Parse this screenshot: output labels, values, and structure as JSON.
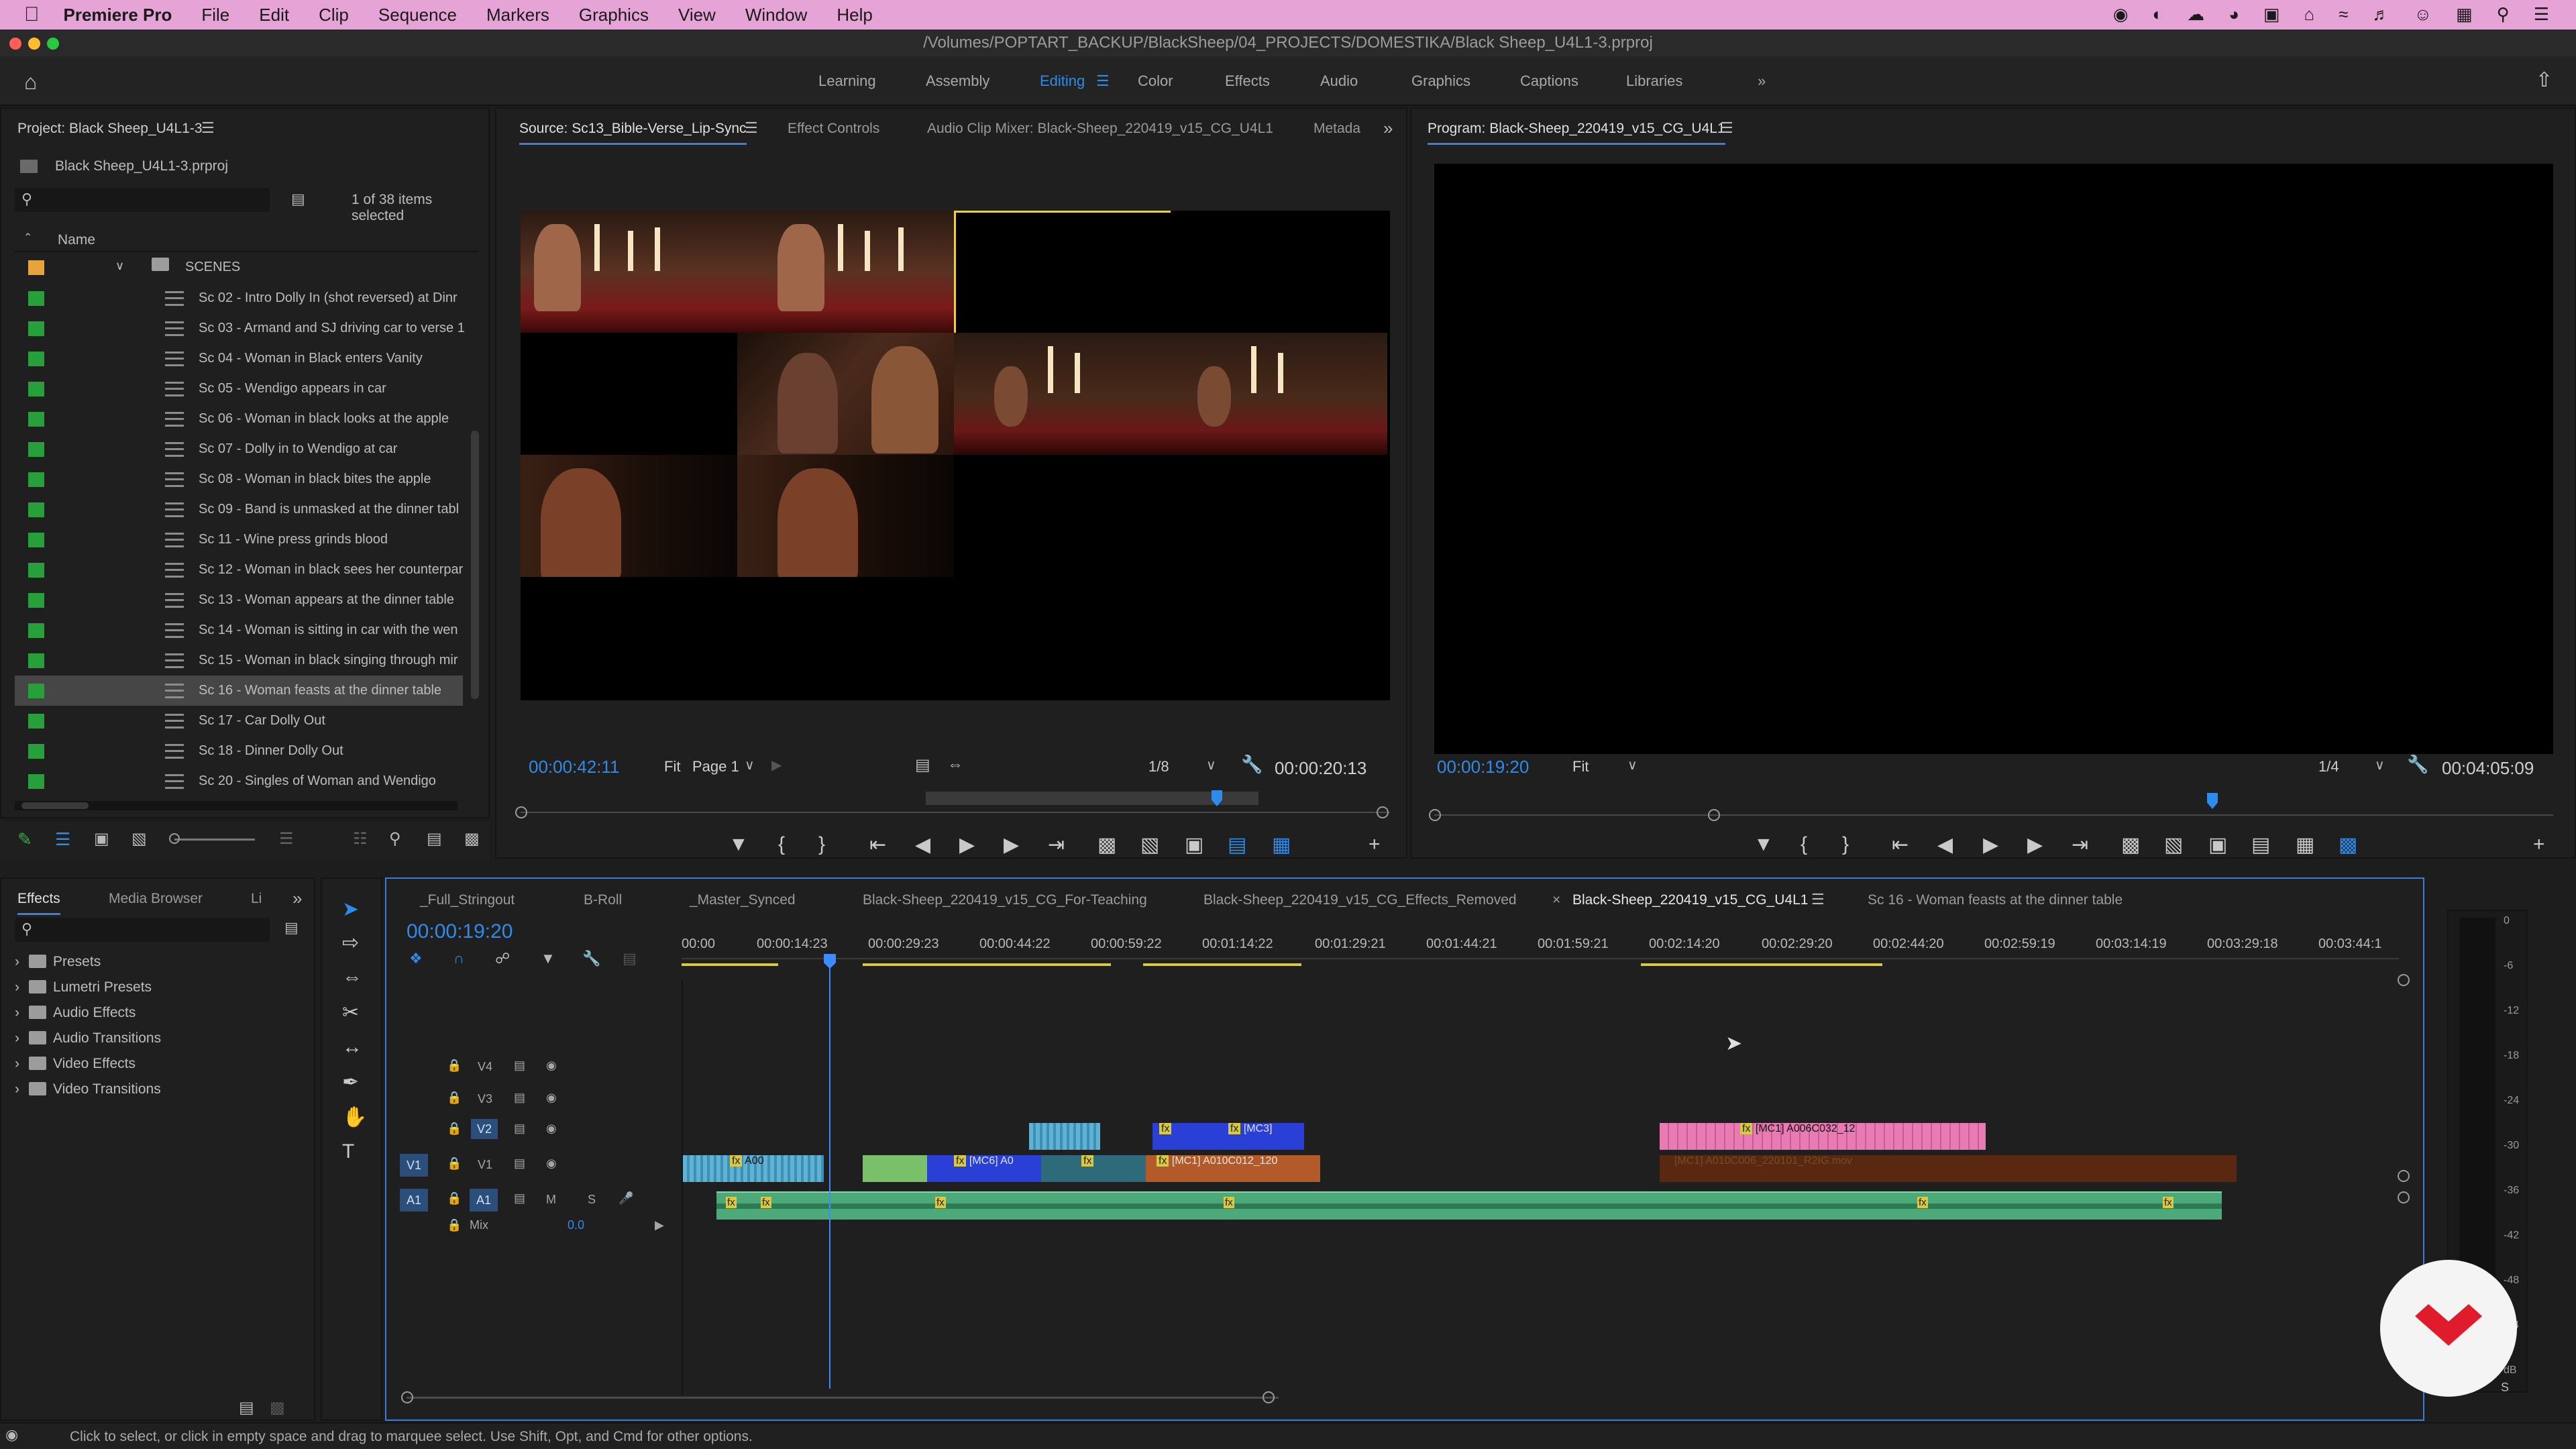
{
  "menubar": {
    "app": "Premiere Pro",
    "items": [
      "File",
      "Edit",
      "Clip",
      "Sequence",
      "Markers",
      "Graphics",
      "View",
      "Window",
      "Help"
    ]
  },
  "window": {
    "title": "/Volumes/POPTART_BACKUP/BlackSheep/04_PROJECTS/DOMESTIKA/Black Sheep_U4L1-3.prproj"
  },
  "workspaces": {
    "items": [
      "Learning",
      "Assembly",
      "Editing",
      "Color",
      "Effects",
      "Audio",
      "Graphics",
      "Captions",
      "Libraries"
    ],
    "active": "Editing"
  },
  "project": {
    "title": "Project: Black Sheep_U4L1-3",
    "file": "Black Sheep_U4L1-3.prproj",
    "search_placeholder": "",
    "selection_info": "1 of 38 items selected",
    "column_name": "Name",
    "folder": "SCENES",
    "items": [
      "Sc 02 - Intro Dolly In (shot reversed) at Dinr",
      "Sc 03 - Armand and SJ driving car to verse 1",
      "Sc 04 - Woman in Black enters Vanity",
      "Sc 05 - Wendigo appears in car",
      "Sc 06 - Woman in black looks at the apple",
      "Sc 07 - Dolly in to Wendigo at car",
      "Sc 08 - Woman in black bites the apple",
      "Sc 09 - Band is unmasked at the dinner tabl",
      "Sc 11 - Wine press grinds blood",
      "Sc 12 - Woman in black sees her counterpar",
      "Sc 13 - Woman appears at the dinner table",
      "Sc 14 - Woman is sitting in car with the wen",
      "Sc 15 - Woman in black singing through mir",
      "Sc 16 - Woman feasts at the dinner table",
      "Sc 17 - Car Dolly Out",
      "Sc 18 - Dinner Dolly Out",
      "Sc 20 - Singles of Woman and Wendigo"
    ],
    "selected_index": 13
  },
  "source": {
    "tabs": [
      "Source: Sc13_Bible-Verse_Lip-Sync",
      "Effect Controls",
      "Audio Clip Mixer: Black-Sheep_220419_v15_CG_U4L1",
      "Metada"
    ],
    "timecode": "00:00:42:11",
    "fit": "Fit",
    "page": "Page 1",
    "resolution": "1/8",
    "duration": "00:00:20:13"
  },
  "program": {
    "title": "Program: Black-Sheep_220419_v15_CG_U4L1",
    "timecode": "00:00:19:20",
    "fit": "Fit",
    "resolution": "1/4",
    "duration": "00:04:05:09"
  },
  "effects": {
    "tabs": [
      "Effects",
      "Media Browser",
      "Li"
    ],
    "items": [
      "Presets",
      "Lumetri Presets",
      "Audio Effects",
      "Audio Transitions",
      "Video Effects",
      "Video Transitions"
    ]
  },
  "timeline": {
    "tabs": [
      "_Full_Stringout",
      "B-Roll",
      "_Master_Synced",
      "Black-Sheep_220419_v15_CG_For-Teaching",
      "Black-Sheep_220419_v15_CG_Effects_Removed",
      "Black-Sheep_220419_v15_CG_U4L1",
      "Sc 16 - Woman feasts at the dinner table"
    ],
    "active_tab": "Black-Sheep_220419_v15_CG_U4L1",
    "close_glyph": "×",
    "timecode": "00:00:19:20",
    "ruler": [
      "00:00",
      "00:00:14:23",
      "00:00:29:23",
      "00:00:44:22",
      "00:00:59:22",
      "00:01:14:22",
      "00:01:29:21",
      "00:01:44:21",
      "00:01:59:21",
      "00:02:14:20",
      "00:02:29:20",
      "00:02:44:20",
      "00:02:59:19",
      "00:03:14:19",
      "00:03:29:18",
      "00:03:44:1"
    ],
    "tracks": {
      "v4": "V4",
      "v3": "V3",
      "v2": "V2",
      "v1": "V1",
      "a1": "A1",
      "mix": "Mix",
      "mix_value": "0.0",
      "m": "M",
      "s": "S"
    },
    "clips": {
      "a00": "A00",
      "mc6": "[MC6] A0",
      "mc1_v1": "[MC1] A010C012_120",
      "mc3": "[MC3]",
      "mc1_v2": "[MC1] A006C032_12",
      "mc1_v1b": "[MC1] A010C006_220101_R2IG.mov",
      "fx": "fx"
    }
  },
  "meter": {
    "labels": [
      "0",
      "-6",
      "-12",
      "-18",
      "-24",
      "-30",
      "-36",
      "-42",
      "-48",
      "-54",
      "dB"
    ],
    "solo": "S"
  },
  "status": {
    "text": "Click to select, or click in empty space and drag to marquee select. Use Shift, Opt, and Cmd for other options."
  }
}
